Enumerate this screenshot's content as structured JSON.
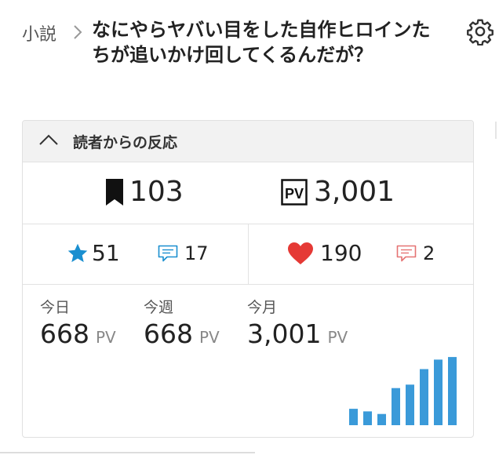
{
  "breadcrumb": {
    "label": "小説"
  },
  "work": {
    "title": "なにやらヤバい目をした自作ヒロインたちが追いかけ回してくるんだが？"
  },
  "icons": {
    "settings": "gear-icon",
    "breadcrumb_sep": "chevron-right-icon",
    "collapse": "chevron-up-icon",
    "bookmark": "bookmark-icon",
    "pv": "pv-icon",
    "star": "star-icon",
    "comment": "comment-icon",
    "heart": "heart-icon",
    "review": "review-comment-icon"
  },
  "reactions": {
    "heading": "読者からの反応",
    "bookmarks": "103",
    "pv_total": "3,001",
    "stars": "51",
    "star_comments": "17",
    "hearts": "190",
    "heart_comments": "2"
  },
  "pv": {
    "unit": "PV",
    "today": {
      "label": "今日",
      "value": "668"
    },
    "week": {
      "label": "今週",
      "value": "668"
    },
    "month": {
      "label": "今月",
      "value": "3,001"
    }
  },
  "colors": {
    "accent_blue": "#1a8fd0",
    "bar_blue": "#3a9ad9",
    "heart_red": "#e53935",
    "comment_red": "#e57373",
    "header_bg": "#f2f2f2"
  },
  "chart_data": {
    "type": "bar",
    "values": [
      19,
      16,
      13,
      43,
      47,
      65,
      76,
      79
    ],
    "ylim": [
      0,
      80
    ]
  }
}
